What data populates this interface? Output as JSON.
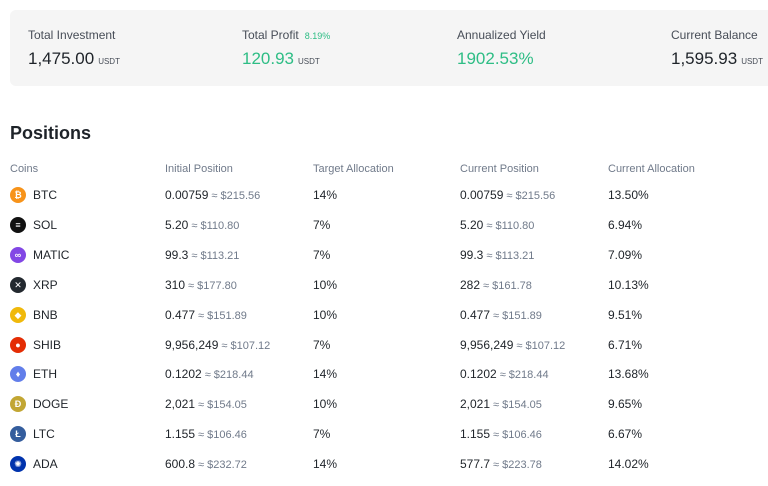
{
  "summary": {
    "total_investment": {
      "label": "Total Investment",
      "value": "1,475.00",
      "unit": "USDT"
    },
    "total_profit": {
      "label": "Total Profit",
      "pct": "8.19%",
      "value": "120.93",
      "unit": "USDT"
    },
    "annualized_yield": {
      "label": "Annualized Yield",
      "value": "1902.53%"
    },
    "current_balance": {
      "label": "Current Balance",
      "value": "1,595.93",
      "unit": "USDT"
    }
  },
  "positions": {
    "title": "Positions",
    "headers": [
      "Coins",
      "Initial Position",
      "Target Allocation",
      "Current Position",
      "Current Allocation"
    ],
    "rows": [
      {
        "coin": "BTC",
        "icon": "bitcoin-icon",
        "icon_color": "#f7931a",
        "init_qty": "0.00759",
        "init_usd": "≈ $215.56",
        "target": "14%",
        "cur_qty": "0.00759",
        "cur_usd": "≈ $215.56",
        "cur_alloc": "13.50%"
      },
      {
        "coin": "SOL",
        "icon": "solana-icon",
        "icon_color": "#111111",
        "init_qty": "5.20",
        "init_usd": "≈ $110.80",
        "target": "7%",
        "cur_qty": "5.20",
        "cur_usd": "≈ $110.80",
        "cur_alloc": "6.94%"
      },
      {
        "coin": "MATIC",
        "icon": "polygon-icon",
        "icon_color": "#8247e5",
        "init_qty": "99.3",
        "init_usd": "≈ $113.21",
        "target": "7%",
        "cur_qty": "99.3",
        "cur_usd": "≈ $113.21",
        "cur_alloc": "7.09%"
      },
      {
        "coin": "XRP",
        "icon": "xrp-icon",
        "icon_color": "#23292f",
        "init_qty": "310",
        "init_usd": "≈ $177.80",
        "target": "10%",
        "cur_qty": "282",
        "cur_usd": "≈ $161.78",
        "cur_alloc": "10.13%"
      },
      {
        "coin": "BNB",
        "icon": "bnb-icon",
        "icon_color": "#f0b90b",
        "init_qty": "0.477",
        "init_usd": "≈ $151.89",
        "target": "10%",
        "cur_qty": "0.477",
        "cur_usd": "≈ $151.89",
        "cur_alloc": "9.51%"
      },
      {
        "coin": "SHIB",
        "icon": "shiba-inu-icon",
        "icon_color": "#e42d04",
        "init_qty": "9,956,249",
        "init_usd": "≈ $107.12",
        "target": "7%",
        "cur_qty": "9,956,249",
        "cur_usd": "≈ $107.12",
        "cur_alloc": "6.71%"
      },
      {
        "coin": "ETH",
        "icon": "ethereum-icon",
        "icon_color": "#627eea",
        "init_qty": "0.1202",
        "init_usd": "≈ $218.44",
        "target": "14%",
        "cur_qty": "0.1202",
        "cur_usd": "≈ $218.44",
        "cur_alloc": "13.68%"
      },
      {
        "coin": "DOGE",
        "icon": "dogecoin-icon",
        "icon_color": "#c2a633",
        "init_qty": "2,021",
        "init_usd": "≈ $154.05",
        "target": "10%",
        "cur_qty": "2,021",
        "cur_usd": "≈ $154.05",
        "cur_alloc": "9.65%"
      },
      {
        "coin": "LTC",
        "icon": "litecoin-icon",
        "icon_color": "#345d9d",
        "init_qty": "1.155",
        "init_usd": "≈ $106.46",
        "target": "7%",
        "cur_qty": "1.155",
        "cur_usd": "≈ $106.46",
        "cur_alloc": "6.67%"
      },
      {
        "coin": "ADA",
        "icon": "cardano-icon",
        "icon_color": "#0033ad",
        "init_qty": "600.8",
        "init_usd": "≈ $232.72",
        "target": "14%",
        "cur_qty": "577.7",
        "cur_usd": "≈ $223.78",
        "cur_alloc": "14.02%"
      }
    ]
  }
}
